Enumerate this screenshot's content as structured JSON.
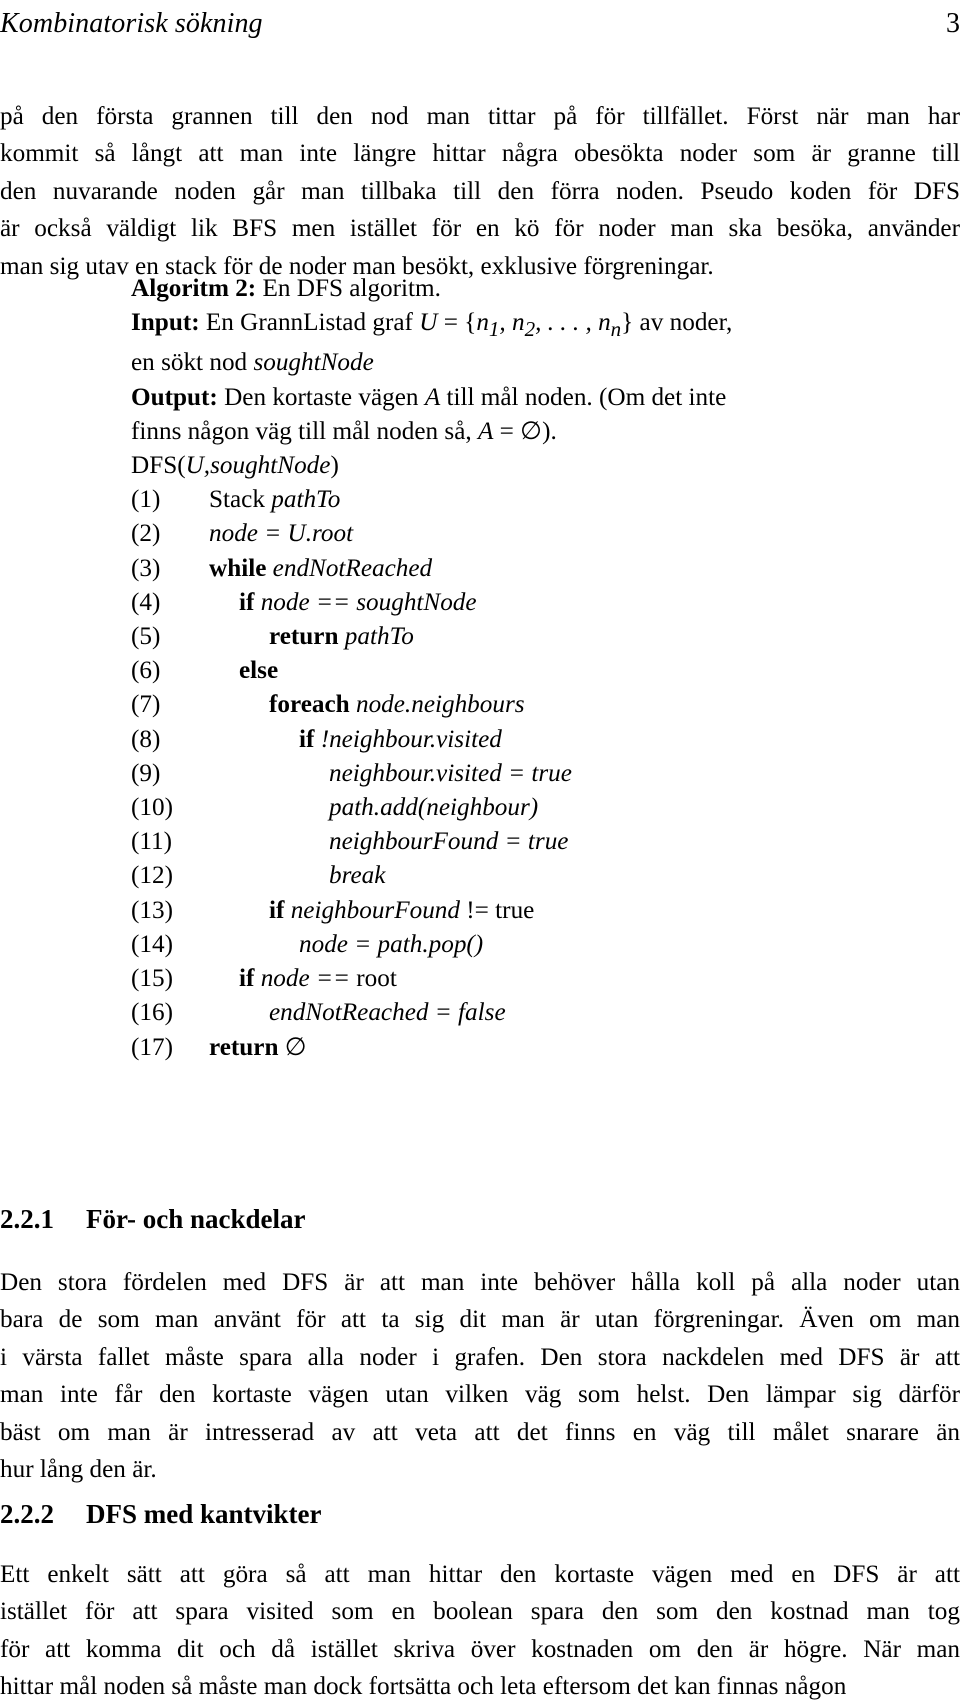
{
  "header": {
    "title": "Kombinatorisk sökning",
    "page_number": "3"
  },
  "intro_paragraph": {
    "lines": [
      "på den första grannen till den nod man tittar på för tillfället. Först när man har",
      "kommit så långt att man inte längre hittar några obesökta noder som är granne till",
      "den nuvarande noden går man tillbaka till den förra noden. Pseudo koden för DFS",
      "är också väldigt lik BFS men istället för en kö för noder man ska besöka, använder",
      "man sig utav en stack för de noder man besökt, exklusive förgreningar."
    ]
  },
  "algorithm": {
    "caption_label": "Algoritm 2:",
    "caption_text": "En DFS algoritm.",
    "input_label": "Input:",
    "input_text_a": "En GrannListad graf ",
    "input_var_U": "U",
    "input_eq": " = {",
    "input_nodes": "n",
    "input_sub1": "1",
    "input_comma1": ", n",
    "input_sub2": "2",
    "input_dots": ", . . . , n",
    "input_subn": "n",
    "input_close": "} av noder,",
    "input_line2_a": "en sökt nod ",
    "input_line2_var": "soughtNode",
    "output_label": "Output:",
    "output_text_a": "Den kortaste vägen ",
    "output_var_A": "A",
    "output_text_b": " till mål noden.  (Om det inte",
    "output_line2_a": "finns någon väg till mål noden så, ",
    "output_line2_var": "A",
    "output_line2_b": " = ∅).",
    "signature_a": "DFS(",
    "signature_var_u": "U",
    "signature_comma": ",",
    "signature_var_node": "soughtNode",
    "signature_close": ")",
    "lines": [
      {
        "num": "(1)",
        "indent": 1,
        "keyword": "",
        "plain_prefix": "Stack ",
        "expr": "pathTo",
        "suffix": ""
      },
      {
        "num": "(2)",
        "indent": 1,
        "keyword": "",
        "plain_prefix": "",
        "expr": "node = U.root",
        "suffix": ""
      },
      {
        "num": "(3)",
        "indent": 1,
        "keyword": "while",
        "plain_prefix": "",
        "expr": "endNotReached",
        "suffix": ""
      },
      {
        "num": "(4)",
        "indent": 2,
        "keyword": "if",
        "plain_prefix": "",
        "expr": "node == soughtNode",
        "suffix": ""
      },
      {
        "num": "(5)",
        "indent": 3,
        "keyword": "return",
        "plain_prefix": "",
        "expr": "pathTo",
        "suffix": ""
      },
      {
        "num": "(6)",
        "indent": 2,
        "keyword": "else",
        "plain_prefix": "",
        "expr": "",
        "suffix": ""
      },
      {
        "num": "(7)",
        "indent": 3,
        "keyword": "foreach",
        "plain_prefix": "",
        "expr": "node.neighbours",
        "suffix": ""
      },
      {
        "num": "(8)",
        "indent": 4,
        "keyword": "if",
        "plain_prefix": "",
        "expr": "!neighbour.visited",
        "suffix": ""
      },
      {
        "num": "(9)",
        "indent": 5,
        "keyword": "",
        "plain_prefix": "",
        "expr": "neighbour.visited = true",
        "suffix": ""
      },
      {
        "num": "(10)",
        "indent": 5,
        "keyword": "",
        "plain_prefix": "",
        "expr": "path.add(neighbour)",
        "suffix": ""
      },
      {
        "num": "(11)",
        "indent": 5,
        "keyword": "",
        "plain_prefix": "",
        "expr": "neighbourFound = true",
        "suffix": ""
      },
      {
        "num": "(12)",
        "indent": 5,
        "keyword": "",
        "plain_prefix": "",
        "expr": "break",
        "suffix": ""
      },
      {
        "num": "(13)",
        "indent": 3,
        "keyword": "if",
        "plain_prefix": "",
        "expr": "neighbourFound ",
        "suffix": "!= true"
      },
      {
        "num": "(14)",
        "indent": 4,
        "keyword": "",
        "plain_prefix": "",
        "expr": "node = path.pop()",
        "suffix": ""
      },
      {
        "num": "(15)",
        "indent": 2,
        "keyword": "if",
        "plain_prefix": "",
        "expr": "node == ",
        "suffix": "root"
      },
      {
        "num": "(16)",
        "indent": 3,
        "keyword": "",
        "plain_prefix": "",
        "expr": "endNotReached = false",
        "suffix": ""
      },
      {
        "num": "(17)",
        "indent": 1,
        "keyword": "return",
        "plain_prefix": "",
        "expr": "",
        "suffix": "∅"
      }
    ]
  },
  "section_1": {
    "number": "2.2.1",
    "title": "För- och nackdelar",
    "paragraph_lines": [
      "Den stora fördelen med DFS är att man inte behöver hålla koll på alla noder utan",
      "bara de som man använt för att ta sig dit man är utan förgreningar. Även om man",
      "i värsta fallet måste spara alla noder i grafen. Den stora nackdelen med DFS är att",
      "man inte får den kortaste vägen utan vilken väg som helst. Den lämpar sig därför",
      "bäst om man är intresserad av att veta att det finns en väg till målet snarare än",
      "hur lång den är."
    ]
  },
  "section_2": {
    "number": "2.2.2",
    "title": "DFS med kantvikter",
    "paragraph_lines": [
      "Ett enkelt sätt att göra så att man hittar den kortaste vägen med en DFS är att",
      "istället för att spara visited som en boolean spara den som den kostnad man tog",
      "för att komma dit och då istället skriva över kostnaden om den är högre. När man",
      "hittar mål noden så måste man dock fortsätta och leta eftersom det kan finnas någon"
    ]
  }
}
